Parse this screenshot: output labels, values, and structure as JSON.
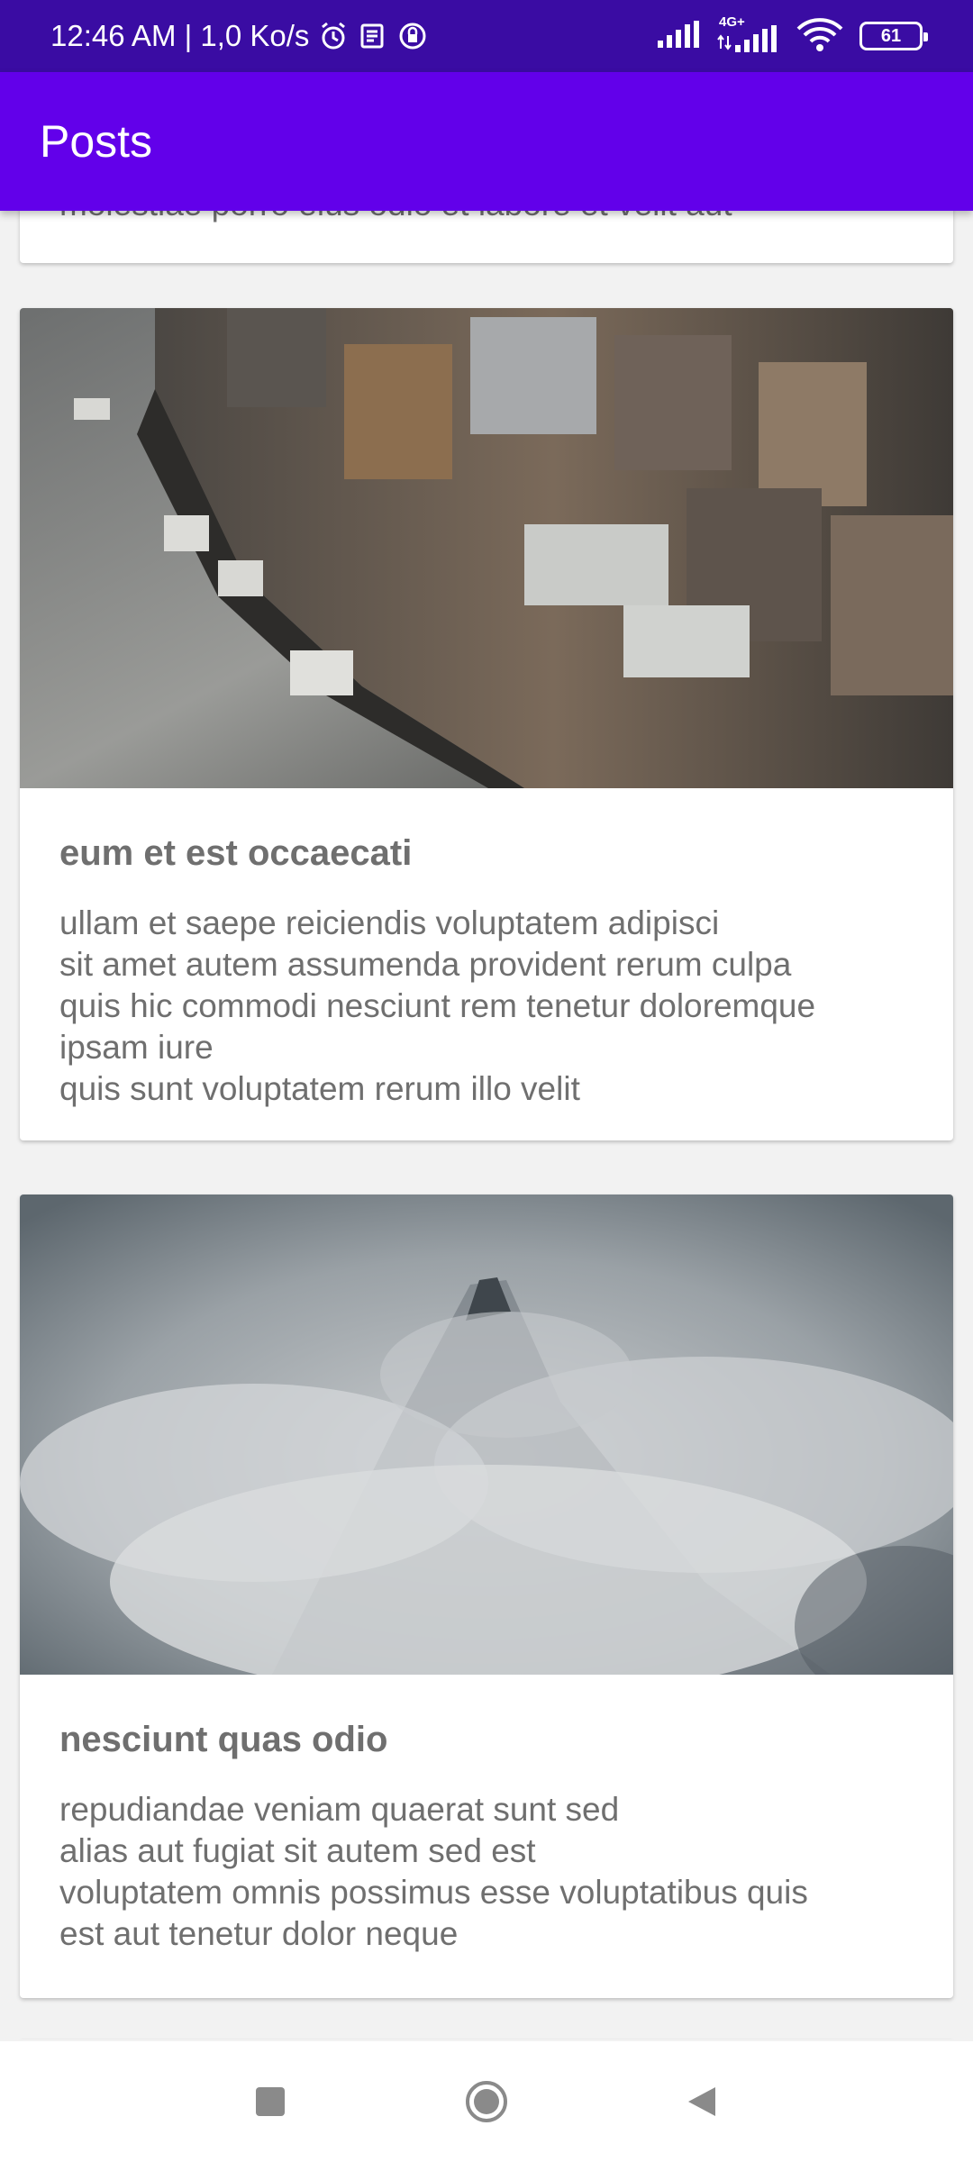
{
  "status_bar": {
    "time_speed": "12:46 AM | 1,0 Ko/s",
    "network_label": "4G+",
    "battery": "61"
  },
  "app_bar": {
    "title": "Posts"
  },
  "posts": [
    {
      "title": "",
      "body": "molestiae porro eius odio et labore et velit aut"
    },
    {
      "title": "eum et est occaecati",
      "body": "ullam et saepe reiciendis voluptatem adipisci\nsit amet autem assumenda provident rerum culpa\nquis hic commodi nesciunt rem tenetur doloremque\nipsam iure\nquis sunt voluptatem rerum illo velit"
    },
    {
      "title": "nesciunt quas odio",
      "body": "repudiandae veniam quaerat sunt sed\nalias aut fugiat sit autem sed est\nvoluptatem omnis possimus esse voluptatibus quis\nest aut tenetur dolor neque"
    }
  ],
  "images": {
    "post_1": "aerial city riverside photo",
    "post_2": "misty mountain peak in clouds photo"
  },
  "icons": {
    "alarm": "alarm-icon",
    "news": "news-icon",
    "vpn": "vpn-icon",
    "signal": "signal-icon",
    "wifi": "wifi-icon",
    "battery": "battery-icon",
    "nav_recent": "recent-apps-icon",
    "nav_home": "home-icon",
    "nav_back": "back-icon"
  },
  "colors": {
    "status_bar": "#3a0ca3",
    "app_bar": "#6200ea",
    "text": "#6f6f6f",
    "background": "#f2f2f2"
  }
}
